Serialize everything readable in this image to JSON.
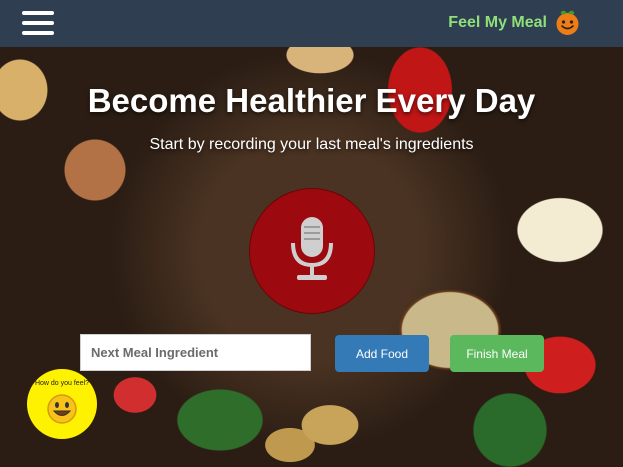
{
  "header": {
    "brand": "Feel My Meal",
    "menu_icon": "hamburger-icon",
    "logo_icon": "orange-smiley-logo"
  },
  "hero": {
    "title": "Become Healthier Every Day",
    "subtitle": "Start by recording your last meal's ingredients"
  },
  "mic": {
    "icon": "microphone-icon",
    "color": "#9c0a10"
  },
  "form": {
    "ingredient_placeholder": "Next Meal Ingredient",
    "add_label": "Add Food",
    "finish_label": "Finish Meal",
    "add_color": "#337ab7",
    "finish_color": "#5cb85c"
  },
  "mood": {
    "prompt": "How do you feel?",
    "icon": "smiley-face-icon",
    "color": "#fff200"
  },
  "colors": {
    "topbar": "#2f3e50",
    "brand_text": "#8fe07a"
  }
}
